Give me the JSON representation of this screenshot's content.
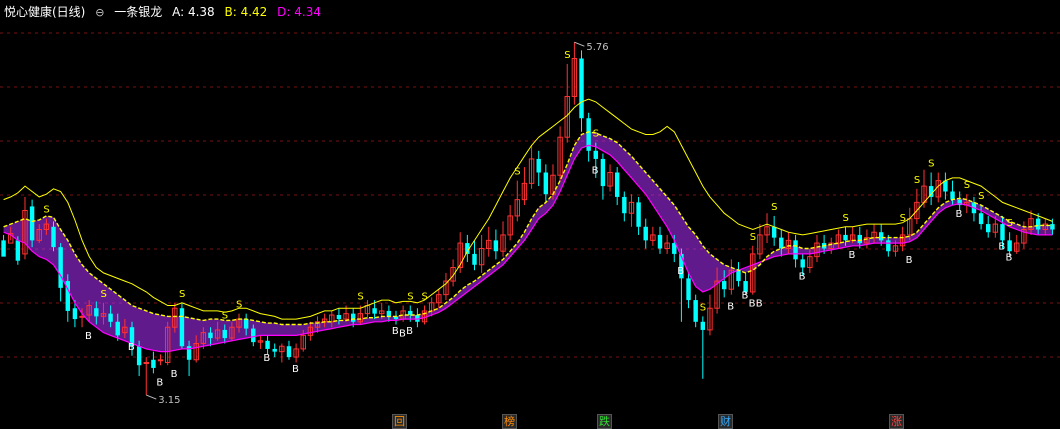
{
  "header": {
    "title": "悦心健康(日线)",
    "control_icon": "circle-minus-icon",
    "indicator_name": "一条银龙",
    "a_label": "A: 4.38",
    "b_label": "B: 4.42",
    "d_label": "D: 4.34",
    "colors": {
      "a": "#ffffff",
      "b": "#ffff00",
      "d": "#ff00ff"
    }
  },
  "bottom_badges": [
    {
      "label": "回",
      "color": "#ff8c00"
    },
    {
      "label": "榜",
      "color": "#ff8c00"
    },
    {
      "label": "跌",
      "color": "#33dd33"
    },
    {
      "label": "财",
      "color": "#33aaff"
    },
    {
      "label": "涨",
      "color": "#ff4444"
    }
  ],
  "chart_data": {
    "type": "candlestick",
    "price_high_label": "5.76",
    "price_low_label": "3.15",
    "ylim": [
      3.05,
      5.85
    ],
    "grid": "horizontal dashed",
    "colors": {
      "up": "#ff3232",
      "down": "#00ffff",
      "line_a": "#ffff00",
      "line_d": "#ff00ff",
      "ribbon": "#b030ff",
      "signal": "#ffff00"
    },
    "candles": [
      [
        4.3,
        4.18,
        4.22,
        4.34
      ],
      [
        4.28,
        4.35,
        4.3,
        4.4
      ],
      [
        4.3,
        4.15,
        4.12,
        4.33
      ],
      [
        4.2,
        4.52,
        4.16,
        4.62
      ],
      [
        4.55,
        4.3,
        4.25,
        4.6
      ],
      [
        4.3,
        4.38,
        4.28,
        4.42
      ],
      [
        4.38,
        4.42,
        4.34,
        4.46
      ],
      [
        4.4,
        4.25,
        4.22,
        4.44
      ],
      [
        4.25,
        3.95,
        3.85,
        4.28
      ],
      [
        4.0,
        3.78,
        3.7,
        4.05
      ],
      [
        3.8,
        3.72,
        3.66,
        3.86
      ],
      [
        3.74,
        3.74,
        3.66,
        3.8
      ],
      [
        3.75,
        3.82,
        3.7,
        3.86
      ],
      [
        3.8,
        3.74,
        3.68,
        3.85
      ],
      [
        3.74,
        3.76,
        3.68,
        3.84
      ],
      [
        3.76,
        3.7,
        3.66,
        3.82
      ],
      [
        3.7,
        3.6,
        3.56,
        3.76
      ],
      [
        3.62,
        3.66,
        3.58,
        3.72
      ],
      [
        3.66,
        3.52,
        3.45,
        3.7
      ],
      [
        3.52,
        3.38,
        3.3,
        3.56
      ],
      [
        3.4,
        3.4,
        3.16,
        3.44
      ],
      [
        3.42,
        3.36,
        3.32,
        3.48
      ],
      [
        3.42,
        3.42,
        3.38,
        3.46
      ],
      [
        3.4,
        3.66,
        3.38,
        3.7
      ],
      [
        3.66,
        3.8,
        3.62,
        3.84
      ],
      [
        3.8,
        3.52,
        3.5,
        3.84
      ],
      [
        3.52,
        3.42,
        3.3,
        3.56
      ],
      [
        3.42,
        3.54,
        3.4,
        3.6
      ],
      [
        3.54,
        3.62,
        3.5,
        3.66
      ],
      [
        3.62,
        3.58,
        3.52,
        3.66
      ],
      [
        3.58,
        3.64,
        3.56,
        3.7
      ],
      [
        3.64,
        3.58,
        3.54,
        3.68
      ],
      [
        3.58,
        3.66,
        3.56,
        3.7
      ],
      [
        3.66,
        3.72,
        3.62,
        3.76
      ],
      [
        3.72,
        3.65,
        3.6,
        3.76
      ],
      [
        3.65,
        3.55,
        3.52,
        3.68
      ],
      [
        3.55,
        3.56,
        3.5,
        3.6
      ],
      [
        3.56,
        3.5,
        3.46,
        3.6
      ],
      [
        3.5,
        3.48,
        3.44,
        3.54
      ],
      [
        3.48,
        3.52,
        3.4,
        3.54
      ],
      [
        3.52,
        3.44,
        3.42,
        3.56
      ],
      [
        3.44,
        3.5,
        3.4,
        3.54
      ],
      [
        3.5,
        3.6,
        3.48,
        3.64
      ],
      [
        3.6,
        3.66,
        3.56,
        3.7
      ],
      [
        3.66,
        3.7,
        3.62,
        3.74
      ],
      [
        3.7,
        3.72,
        3.66,
        3.76
      ],
      [
        3.7,
        3.75,
        3.66,
        3.78
      ],
      [
        3.75,
        3.72,
        3.68,
        3.8
      ],
      [
        3.72,
        3.76,
        3.7,
        3.82
      ],
      [
        3.76,
        3.7,
        3.66,
        3.8
      ],
      [
        3.7,
        3.76,
        3.68,
        3.82
      ],
      [
        3.76,
        3.82,
        3.72,
        3.86
      ],
      [
        3.8,
        3.76,
        3.72,
        3.86
      ],
      [
        3.76,
        3.78,
        3.72,
        3.84
      ],
      [
        3.78,
        3.74,
        3.7,
        3.82
      ],
      [
        3.74,
        3.72,
        3.68,
        3.78
      ],
      [
        3.72,
        3.78,
        3.7,
        3.82
      ],
      [
        3.78,
        3.75,
        3.7,
        3.82
      ],
      [
        3.75,
        3.7,
        3.66,
        3.8
      ],
      [
        3.7,
        3.78,
        3.68,
        3.82
      ],
      [
        3.78,
        3.84,
        3.74,
        3.88
      ],
      [
        3.84,
        3.9,
        3.8,
        3.94
      ],
      [
        3.9,
        4.0,
        3.86,
        4.06
      ],
      [
        4.0,
        4.1,
        3.96,
        4.16
      ],
      [
        4.1,
        4.28,
        4.06,
        4.36
      ],
      [
        4.28,
        4.2,
        4.14,
        4.34
      ],
      [
        4.2,
        4.12,
        4.08,
        4.3
      ],
      [
        4.12,
        4.24,
        4.06,
        4.34
      ],
      [
        4.24,
        4.3,
        4.18,
        4.4
      ],
      [
        4.3,
        4.22,
        4.16,
        4.38
      ],
      [
        4.22,
        4.34,
        4.18,
        4.44
      ],
      [
        4.34,
        4.48,
        4.3,
        4.56
      ],
      [
        4.48,
        4.6,
        4.44,
        4.74
      ],
      [
        4.6,
        4.72,
        4.56,
        4.84
      ],
      [
        4.72,
        4.9,
        4.68,
        5.0
      ],
      [
        4.9,
        4.8,
        4.7,
        4.96
      ],
      [
        4.8,
        4.64,
        4.58,
        4.86
      ],
      [
        4.64,
        4.78,
        4.6,
        4.86
      ],
      [
        4.78,
        5.06,
        4.74,
        5.14
      ],
      [
        5.06,
        5.36,
        5.02,
        5.6
      ],
      [
        5.36,
        5.64,
        5.3,
        5.76
      ],
      [
        5.64,
        5.2,
        5.1,
        5.7
      ],
      [
        5.2,
        4.96,
        4.88,
        5.24
      ],
      [
        4.96,
        4.9,
        4.76,
        5.02
      ],
      [
        4.9,
        4.7,
        4.6,
        4.94
      ],
      [
        4.7,
        4.8,
        4.66,
        4.86
      ],
      [
        4.8,
        4.62,
        4.56,
        4.84
      ],
      [
        4.62,
        4.5,
        4.44,
        4.66
      ],
      [
        4.5,
        4.58,
        4.4,
        4.64
      ],
      [
        4.58,
        4.4,
        4.34,
        4.62
      ],
      [
        4.4,
        4.3,
        4.24,
        4.46
      ],
      [
        4.3,
        4.34,
        4.26,
        4.4
      ],
      [
        4.34,
        4.24,
        4.2,
        4.4
      ],
      [
        4.24,
        4.28,
        4.2,
        4.34
      ],
      [
        4.28,
        4.2,
        4.14,
        4.34
      ],
      [
        4.2,
        4.02,
        3.7,
        4.24
      ],
      [
        4.02,
        3.86,
        3.8,
        4.06
      ],
      [
        3.86,
        3.7,
        3.66,
        3.9
      ],
      [
        3.7,
        3.64,
        3.28,
        3.74
      ],
      [
        3.64,
        3.8,
        3.6,
        3.9
      ],
      [
        3.8,
        4.0,
        3.76,
        4.1
      ],
      [
        4.0,
        3.94,
        3.88,
        4.08
      ],
      [
        3.94,
        4.08,
        3.9,
        4.16
      ],
      [
        4.08,
        4.0,
        3.96,
        4.14
      ],
      [
        4.0,
        3.92,
        3.9,
        4.06
      ],
      [
        3.92,
        4.2,
        3.9,
        4.26
      ],
      [
        4.2,
        4.34,
        4.16,
        4.42
      ],
      [
        4.34,
        4.4,
        4.28,
        4.5
      ],
      [
        4.4,
        4.32,
        4.26,
        4.48
      ],
      [
        4.32,
        4.24,
        4.18,
        4.38
      ],
      [
        4.24,
        4.3,
        4.2,
        4.36
      ],
      [
        4.3,
        4.16,
        4.1,
        4.34
      ],
      [
        4.16,
        4.1,
        4.04,
        4.2
      ],
      [
        4.1,
        4.18,
        4.06,
        4.24
      ],
      [
        4.18,
        4.28,
        4.14,
        4.34
      ],
      [
        4.28,
        4.24,
        4.2,
        4.34
      ],
      [
        4.24,
        4.28,
        4.2,
        4.32
      ],
      [
        4.28,
        4.34,
        4.24,
        4.38
      ],
      [
        4.34,
        4.3,
        4.26,
        4.4
      ],
      [
        4.3,
        4.34,
        4.28,
        4.4
      ],
      [
        4.34,
        4.28,
        4.24,
        4.4
      ],
      [
        4.28,
        4.32,
        4.24,
        4.38
      ],
      [
        4.32,
        4.36,
        4.28,
        4.42
      ],
      [
        4.36,
        4.3,
        4.26,
        4.42
      ],
      [
        4.3,
        4.22,
        4.18,
        4.34
      ],
      [
        4.22,
        4.26,
        4.18,
        4.3
      ],
      [
        4.26,
        4.34,
        4.22,
        4.4
      ],
      [
        4.34,
        4.46,
        4.3,
        4.54
      ],
      [
        4.46,
        4.58,
        4.42,
        4.68
      ],
      [
        4.58,
        4.7,
        4.54,
        4.82
      ],
      [
        4.7,
        4.62,
        4.56,
        4.8
      ],
      [
        4.62,
        4.74,
        4.58,
        4.8
      ],
      [
        4.74,
        4.66,
        4.6,
        4.8
      ],
      [
        4.66,
        4.6,
        4.56,
        4.74
      ],
      [
        4.6,
        4.56,
        4.52,
        4.66
      ],
      [
        4.56,
        4.58,
        4.5,
        4.64
      ],
      [
        4.58,
        4.5,
        4.44,
        4.62
      ],
      [
        4.5,
        4.42,
        4.38,
        4.56
      ],
      [
        4.42,
        4.36,
        4.32,
        4.48
      ],
      [
        4.36,
        4.42,
        4.32,
        4.48
      ],
      [
        4.42,
        4.3,
        4.24,
        4.48
      ],
      [
        4.3,
        4.22,
        4.18,
        4.36
      ],
      [
        4.22,
        4.28,
        4.2,
        4.34
      ],
      [
        4.28,
        4.38,
        4.24,
        4.44
      ],
      [
        4.38,
        4.46,
        4.34,
        4.52
      ],
      [
        4.46,
        4.38,
        4.34,
        4.5
      ],
      [
        4.38,
        4.42,
        4.34,
        4.46
      ],
      [
        4.42,
        4.38,
        4.34,
        4.46
      ]
    ],
    "line_a": [
      4.4,
      4.42,
      4.44,
      4.46,
      4.44,
      4.45,
      4.48,
      4.47,
      4.38,
      4.3,
      4.2,
      4.12,
      4.06,
      4.02,
      3.98,
      3.94,
      3.9,
      3.86,
      3.82,
      3.8,
      3.78,
      3.76,
      3.75,
      3.74,
      3.74,
      3.74,
      3.73,
      3.72,
      3.71,
      3.72,
      3.72,
      3.71,
      3.71,
      3.72,
      3.72,
      3.71,
      3.7,
      3.69,
      3.69,
      3.68,
      3.68,
      3.68,
      3.68,
      3.69,
      3.69,
      3.7,
      3.7,
      3.71,
      3.71,
      3.72,
      3.72,
      3.73,
      3.73,
      3.74,
      3.74,
      3.74,
      3.75,
      3.75,
      3.75,
      3.76,
      3.78,
      3.8,
      3.84,
      3.88,
      3.93,
      3.97,
      4.0,
      4.04,
      4.08,
      4.12,
      4.16,
      4.22,
      4.28,
      4.36,
      4.46,
      4.54,
      4.58,
      4.64,
      4.74,
      4.86,
      5.0,
      5.08,
      5.1,
      5.09,
      5.07,
      5.05,
      5.02,
      4.97,
      4.92,
      4.86,
      4.8,
      4.74,
      4.68,
      4.62,
      4.56,
      4.48,
      4.4,
      4.34,
      4.26,
      4.2,
      4.16,
      4.12,
      4.1,
      4.08,
      4.06,
      4.08,
      4.12,
      4.18,
      4.22,
      4.24,
      4.26,
      4.26,
      4.24,
      4.24,
      4.25,
      4.26,
      4.27,
      4.28,
      4.29,
      4.3,
      4.3,
      4.31,
      4.32,
      4.32,
      4.32,
      4.32,
      4.32,
      4.33,
      4.36,
      4.42,
      4.48,
      4.54,
      4.58,
      4.6,
      4.61,
      4.6,
      4.58,
      4.56,
      4.53,
      4.5,
      4.47,
      4.44,
      4.42,
      4.4,
      4.4,
      4.41,
      4.41,
      4.41
    ],
    "line_d": [
      4.36,
      4.34,
      4.3,
      4.28,
      4.22,
      4.18,
      4.16,
      4.12,
      4.04,
      3.94,
      3.84,
      3.76,
      3.7,
      3.66,
      3.62,
      3.6,
      3.58,
      3.56,
      3.54,
      3.52,
      3.5,
      3.49,
      3.48,
      3.48,
      3.49,
      3.5,
      3.5,
      3.51,
      3.52,
      3.53,
      3.54,
      3.55,
      3.56,
      3.57,
      3.58,
      3.59,
      3.6,
      3.6,
      3.6,
      3.6,
      3.6,
      3.6,
      3.61,
      3.62,
      3.63,
      3.64,
      3.65,
      3.66,
      3.67,
      3.68,
      3.68,
      3.69,
      3.7,
      3.7,
      3.71,
      3.71,
      3.72,
      3.72,
      3.72,
      3.73,
      3.75,
      3.77,
      3.8,
      3.84,
      3.88,
      3.92,
      3.96,
      4.0,
      4.04,
      4.08,
      4.12,
      4.18,
      4.24,
      4.3,
      4.38,
      4.46,
      4.5,
      4.56,
      4.66,
      4.78,
      4.9,
      4.98,
      5.0,
      4.99,
      4.96,
      4.93,
      4.88,
      4.82,
      4.76,
      4.7,
      4.64,
      4.56,
      4.48,
      4.4,
      4.3,
      4.18,
      4.06,
      3.96,
      3.92,
      3.94,
      3.98,
      4.02,
      4.06,
      4.08,
      4.1,
      4.12,
      4.14,
      4.16,
      4.18,
      4.19,
      4.2,
      4.2,
      4.2,
      4.2,
      4.21,
      4.22,
      4.23,
      4.24,
      4.25,
      4.26,
      4.26,
      4.27,
      4.28,
      4.28,
      4.28,
      4.28,
      4.28,
      4.29,
      4.32,
      4.38,
      4.44,
      4.5,
      4.54,
      4.56,
      4.57,
      4.56,
      4.54,
      4.52,
      4.49,
      4.46,
      4.43,
      4.4,
      4.38,
      4.36,
      4.35,
      4.34,
      4.34,
      4.34
    ],
    "line_b": [
      4.6,
      4.62,
      4.65,
      4.7,
      4.66,
      4.62,
      4.64,
      4.68,
      4.66,
      4.58,
      4.45,
      4.3,
      4.18,
      4.1,
      4.06,
      4.04,
      4.02,
      4.0,
      3.98,
      3.95,
      3.92,
      3.88,
      3.85,
      3.82,
      3.82,
      3.84,
      3.82,
      3.8,
      3.78,
      3.78,
      3.78,
      3.77,
      3.78,
      3.8,
      3.8,
      3.78,
      3.76,
      3.75,
      3.74,
      3.72,
      3.72,
      3.72,
      3.73,
      3.74,
      3.76,
      3.78,
      3.78,
      3.8,
      3.8,
      3.8,
      3.8,
      3.82,
      3.84,
      3.86,
      3.86,
      3.84,
      3.85,
      3.85,
      3.84,
      3.86,
      3.9,
      3.94,
      3.98,
      4.04,
      4.12,
      4.22,
      4.3,
      4.38,
      4.46,
      4.56,
      4.66,
      4.76,
      4.84,
      4.92,
      5.0,
      5.06,
      5.1,
      5.14,
      5.18,
      5.22,
      5.28,
      5.32,
      5.34,
      5.32,
      5.28,
      5.24,
      5.2,
      5.16,
      5.12,
      5.1,
      5.08,
      5.08,
      5.1,
      5.14,
      5.1,
      5.0,
      4.9,
      4.8,
      4.7,
      4.62,
      4.56,
      4.5,
      4.46,
      4.42,
      4.4,
      4.38,
      4.4,
      4.42,
      4.4,
      4.38,
      4.36,
      4.35,
      4.34,
      4.35,
      4.36,
      4.37,
      4.38,
      4.39,
      4.4,
      4.4,
      4.41,
      4.42,
      4.42,
      4.42,
      4.42,
      4.42,
      4.43,
      4.46,
      4.52,
      4.58,
      4.64,
      4.7,
      4.74,
      4.76,
      4.76,
      4.74,
      4.72,
      4.7,
      4.66,
      4.62,
      4.58,
      4.56,
      4.54,
      4.52,
      4.5,
      4.48,
      4.46,
      4.44
    ],
    "buy_markers": [
      11,
      17,
      21,
      23,
      36,
      40,
      54,
      55,
      56,
      82,
      94,
      101,
      103,
      104,
      105,
      111,
      118,
      126,
      133,
      139,
      140
    ],
    "sell_markers": [
      6,
      14,
      25,
      31,
      33,
      50,
      57,
      59,
      72,
      79,
      83,
      98,
      105,
      108,
      118,
      126,
      128,
      130,
      135,
      137,
      141
    ]
  }
}
